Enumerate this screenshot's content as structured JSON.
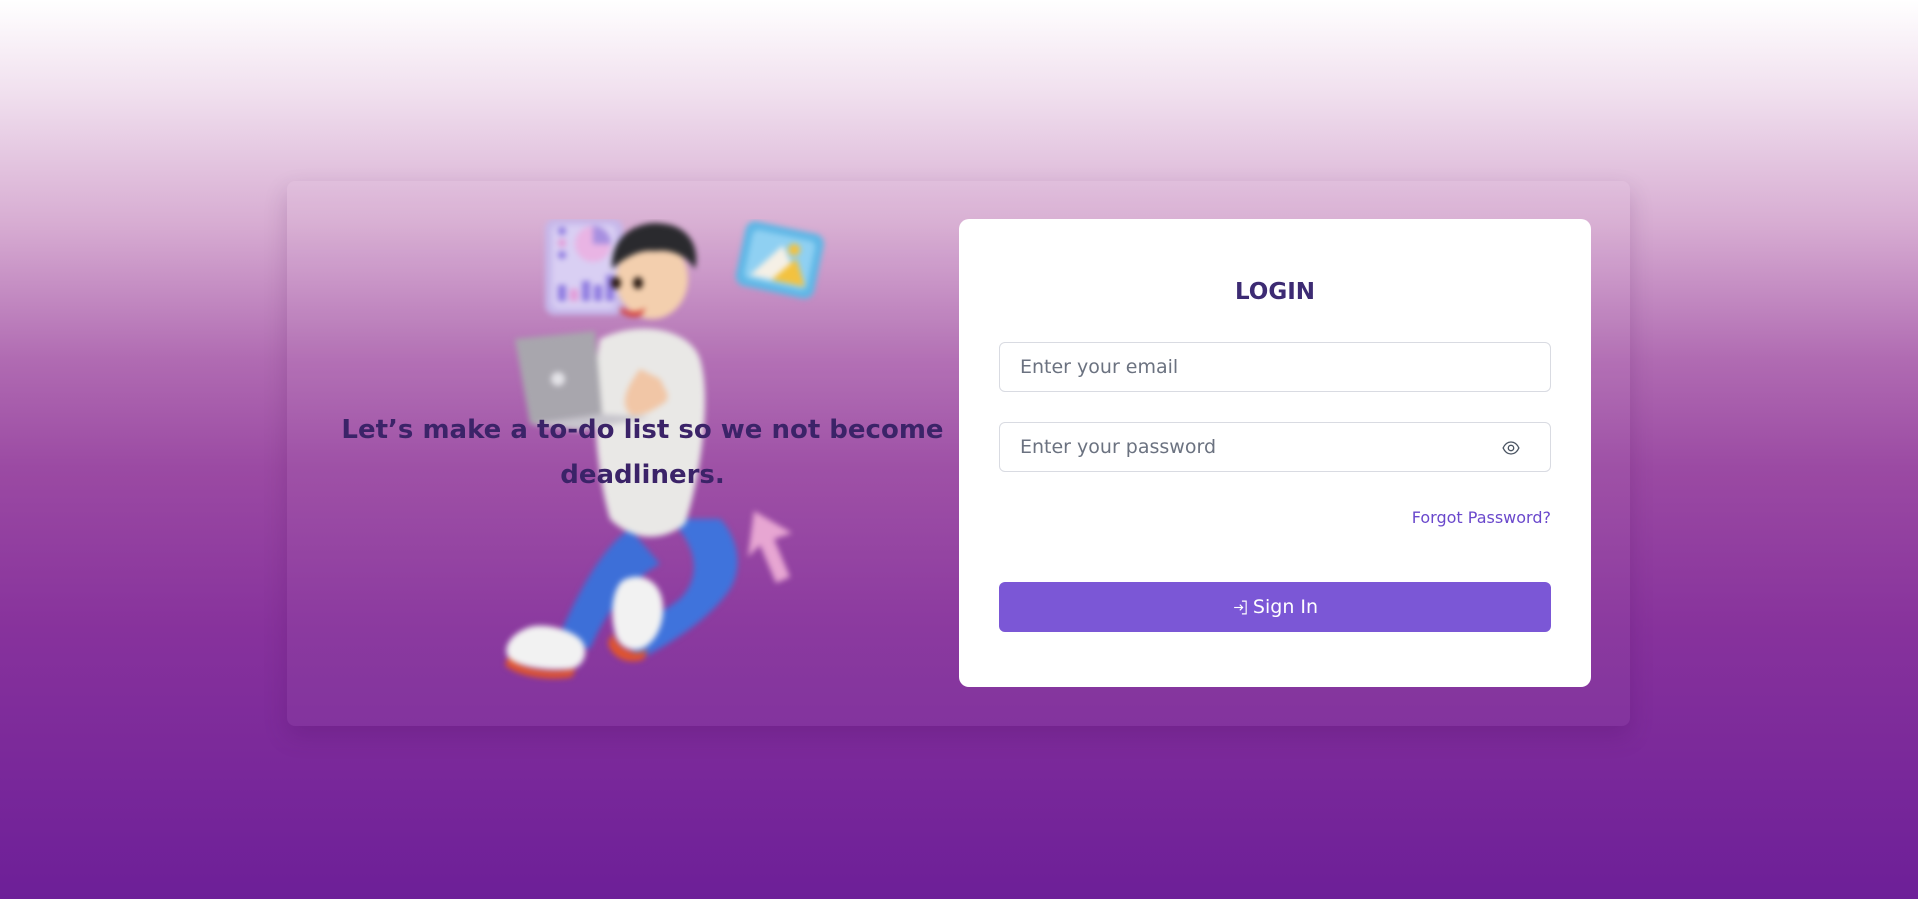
{
  "hero": {
    "tagline": "Let’s make a to-do list so we not become deadliners.",
    "illustration_icon": "person-with-laptop-illustration"
  },
  "login": {
    "title": "LOGIN",
    "email_placeholder": "Enter your email",
    "password_placeholder": "Enter your password",
    "password_toggle_icon": "eye-icon",
    "forgot_password_label": "Forgot Password?",
    "signin_label": "Sign In",
    "signin_icon": "sign-in-icon"
  },
  "colors": {
    "accent": "#7b57d6",
    "title": "#3d2b73",
    "link": "#6a48cc",
    "background_top": "#ffffff",
    "background_bottom": "#6d1f98"
  }
}
